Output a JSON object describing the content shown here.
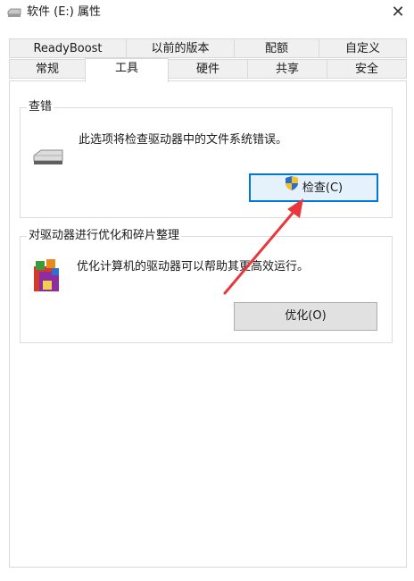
{
  "window": {
    "title": "软件 (E:) 属性",
    "close_label": "✕",
    "icon": "drive-icon"
  },
  "tabs": {
    "row1": [
      "ReadyBoost",
      "以前的版本",
      "配额",
      "自定义"
    ],
    "row2": [
      "常规",
      "工具",
      "硬件",
      "共享",
      "安全"
    ],
    "active": "工具"
  },
  "error_check": {
    "title": "查错",
    "description": "此选项将检查驱动器中的文件系统错误。",
    "button_label": "检查(C)",
    "icon": "hard-drive-icon"
  },
  "optimize": {
    "title": "对驱动器进行优化和碎片整理",
    "description": "优化计算机的驱动器可以帮助其更高效运行。",
    "button_label": "优化(O)",
    "icon": "defrag-icon"
  },
  "colors": {
    "accent": "#0078d7",
    "arrow": "#e8383d"
  }
}
